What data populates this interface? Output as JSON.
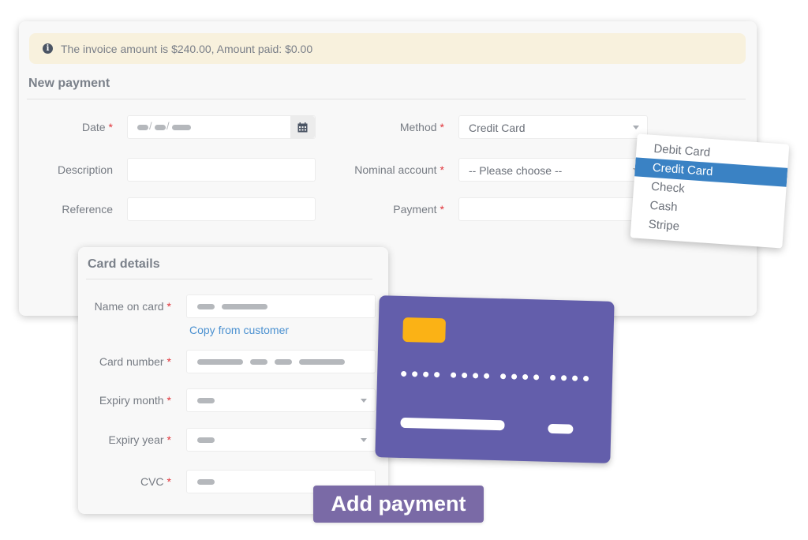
{
  "alert": {
    "icon": "info-icon",
    "text": "The invoice amount is $240.00, Amount paid: $0.00"
  },
  "new_payment": {
    "title": "New payment",
    "fields": {
      "date": {
        "label": "Date",
        "required": "*",
        "value": "",
        "icon": "calendar-icon"
      },
      "description": {
        "label": "Description",
        "value": ""
      },
      "reference": {
        "label": "Reference",
        "value": ""
      },
      "method": {
        "label": "Method",
        "required": "*",
        "value": "Credit Card"
      },
      "nominal_account": {
        "label": "Nominal account",
        "required": "*",
        "value": "-- Please choose --"
      },
      "payment": {
        "label": "Payment",
        "required": "*",
        "value": ""
      }
    }
  },
  "method_dropdown": {
    "options": [
      "Debit Card",
      "Credit Card",
      "Check",
      "Cash",
      "Stripe"
    ],
    "selected": "Credit Card"
  },
  "card_details": {
    "title": "Card details",
    "fields": {
      "name_on_card": {
        "label": "Name on card",
        "required": "*"
      },
      "card_number": {
        "label": "Card number",
        "required": "*"
      },
      "expiry_month": {
        "label": "Expiry month",
        "required": "*"
      },
      "expiry_year": {
        "label": "Expiry year",
        "required": "*"
      },
      "cvc": {
        "label": "CVC",
        "required": "*"
      }
    },
    "copy_link": "Copy from customer"
  },
  "actions": {
    "add_payment": "Add payment"
  },
  "colors": {
    "alert_bg": "#f8f1dd",
    "highlight": "#3a82c4",
    "card": "#635eab",
    "chip": "#fbb215",
    "button": "#7a6aa6",
    "link": "#4a90d0",
    "required": "#e0343a"
  }
}
